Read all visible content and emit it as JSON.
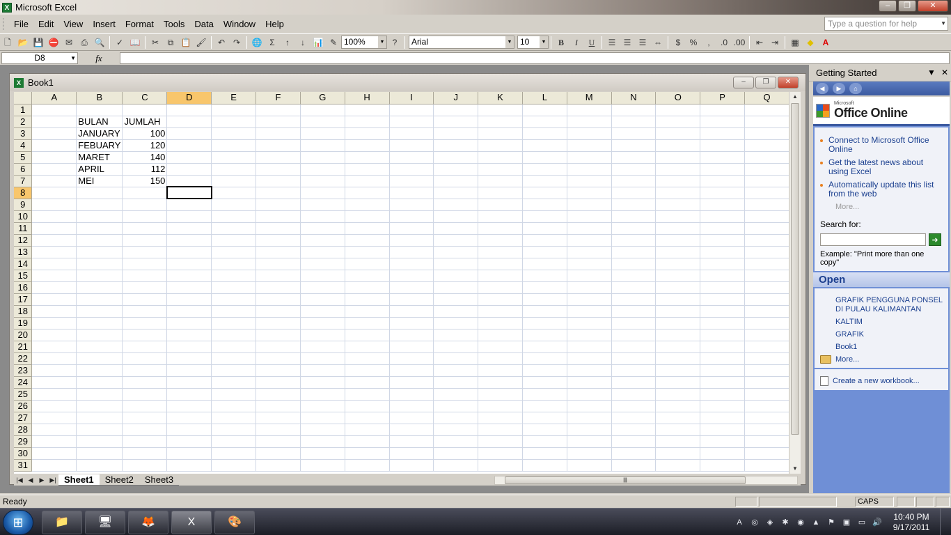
{
  "window": {
    "title": "Microsoft Excel",
    "min": "–",
    "max": "❐",
    "close": "✕"
  },
  "menu": [
    "File",
    "Edit",
    "View",
    "Insert",
    "Format",
    "Tools",
    "Data",
    "Window",
    "Help"
  ],
  "help_box": {
    "placeholder": "Type a question for help"
  },
  "toolbar": {
    "zoom": "100%",
    "font": "Arial",
    "font_size": "10",
    "bold": "B",
    "italic": "I",
    "underline": "U",
    "currency": "$",
    "percent": "%",
    "comma": ",",
    "autosum": "Σ"
  },
  "formula_bar": {
    "name_box": "D8",
    "fx": "fx",
    "formula": ""
  },
  "workbook": {
    "title": "Book1",
    "columns": [
      "A",
      "B",
      "C",
      "D",
      "E",
      "F",
      "G",
      "H",
      "I",
      "J",
      "K",
      "L",
      "M",
      "N",
      "O",
      "P",
      "Q"
    ],
    "active_column": "D",
    "active_row": 8,
    "row_count": 31,
    "cells": {
      "B2": "BULAN",
      "C2": "JUMLAH",
      "B3": "JANUARY",
      "C3": "100",
      "B4": "FEBUARY",
      "C4": "120",
      "B5": "MARET",
      "C5": "140",
      "B6": "APRIL",
      "C6": "112",
      "B7": "MEI",
      "C7": "150"
    },
    "sheets": [
      "Sheet1",
      "Sheet2",
      "Sheet3"
    ],
    "active_sheet": "Sheet1"
  },
  "task_pane": {
    "title": "Getting Started",
    "office_online": {
      "sup": "Microsoft",
      "name": "Office Online"
    },
    "links": [
      "Connect to Microsoft Office Online",
      "Get the latest news about using Excel",
      "Automatically update this list from the web"
    ],
    "more": "More...",
    "search_label": "Search for:",
    "example": "Example:  \"Print more than one copy\"",
    "open_heading": "Open",
    "open_files": [
      "GRAFIK PENGGUNA PONSEL DI PULAU KALIMANTAN",
      "KALTIM",
      "GRAFIK",
      "Book1"
    ],
    "open_more": "More...",
    "create_new": "Create a new workbook..."
  },
  "status": {
    "text": "Ready",
    "caps": "CAPS"
  },
  "taskbar": {
    "time": "10:40 PM",
    "date": "9/17/2011"
  }
}
